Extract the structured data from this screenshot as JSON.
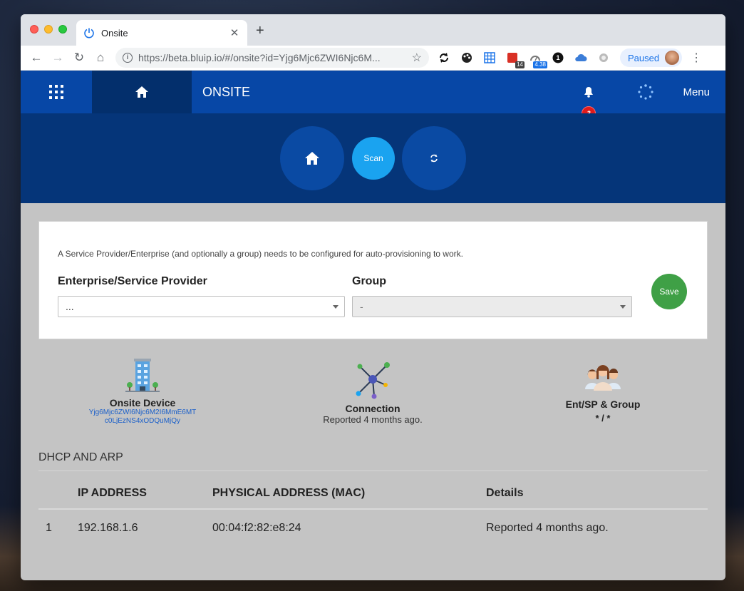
{
  "browser": {
    "tab_title": "Onsite",
    "tab_close": "✕",
    "new_tab": "+",
    "url": "https://beta.bluip.io/#/onsite?id=Yjg6Mjc6ZWI6Njc6M...",
    "ext_badges": [
      "14",
      "4.38"
    ],
    "ext_onepassword": "1",
    "profile_label": "Paused"
  },
  "appbar": {
    "title": "ONSITE",
    "notification_count": "3",
    "menu_label": "Menu"
  },
  "hero": {
    "scan_label": "Scan"
  },
  "config": {
    "note": "A Service Provider/Enterprise (and optionally a group) needs to be configured for auto-provisioning to work.",
    "enterprise_label": "Enterprise/Service Provider",
    "enterprise_value": "...",
    "group_label": "Group",
    "group_value": "-",
    "save_label": "Save"
  },
  "device_info": {
    "onsite_title": "Onsite Device",
    "onsite_id_line1": "Yjg6Mjc6ZWI6Njc6M2I6MmE6MT",
    "onsite_id_line2": "c0LjEzNS4xODQuMjQy",
    "connection_title": "Connection",
    "connection_status": "Reported 4 months ago.",
    "group_title": "Ent/SP & Group",
    "group_value": "* / *"
  },
  "table": {
    "section_title": "DHCP AND ARP",
    "headers": [
      "IP ADDRESS",
      "PHYSICAL ADDRESS (MAC)",
      "Details"
    ],
    "rows": [
      {
        "index": "1",
        "ip": "192.168.1.6",
        "mac": "00:04:f2:82:e8:24",
        "details": "Reported 4 months ago."
      }
    ]
  },
  "colors": {
    "appbar": "#0747a6",
    "hero": "#053579",
    "scan": "#1aa3f0",
    "save": "#3fa046",
    "badge": "#e11b1b"
  }
}
